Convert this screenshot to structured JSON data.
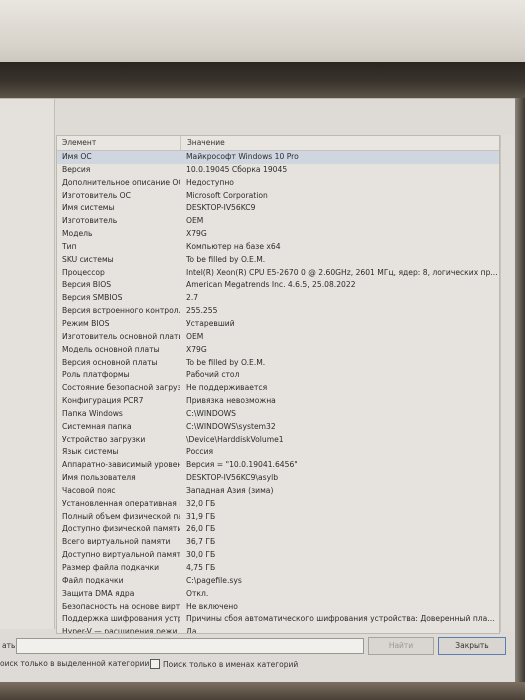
{
  "table": {
    "headers": {
      "element": "Элемент",
      "value": "Значение"
    },
    "rows": [
      {
        "k": "Имя ОС",
        "v": "Майкрософт Windows 10 Pro"
      },
      {
        "k": "Версия",
        "v": "10.0.19045 Сборка 19045"
      },
      {
        "k": "Дополнительное описание ОС",
        "v": "Недоступно"
      },
      {
        "k": "Изготовитель ОС",
        "v": "Microsoft Corporation"
      },
      {
        "k": "Имя системы",
        "v": "DESKTOP-IV56KC9"
      },
      {
        "k": "Изготовитель",
        "v": "OEM"
      },
      {
        "k": "Модель",
        "v": "X79G"
      },
      {
        "k": "Тип",
        "v": "Компьютер на базе x64"
      },
      {
        "k": "SKU системы",
        "v": "To be filled by O.E.M."
      },
      {
        "k": "Процессор",
        "v": "Intel(R) Xeon(R) CPU E5-2670 0 @ 2.60GHz, 2601 МГц, ядер: 8, логических пр..."
      },
      {
        "k": "Версия BIOS",
        "v": "American Megatrends Inc. 4.6.5, 25.08.2022"
      },
      {
        "k": "Версия SMBIOS",
        "v": "2.7"
      },
      {
        "k": "Версия встроенного контролл...",
        "v": "255.255"
      },
      {
        "k": "Режим BIOS",
        "v": "Устаревший"
      },
      {
        "k": "Изготовитель основной платы",
        "v": "OEM"
      },
      {
        "k": "Модель основной платы",
        "v": "X79G"
      },
      {
        "k": "Версия основной платы",
        "v": "To be filled by O.E.M."
      },
      {
        "k": "Роль платформы",
        "v": "Рабочий стол"
      },
      {
        "k": "Состояние безопасной загруз...",
        "v": "Не поддерживается"
      },
      {
        "k": "Конфигурация PCR7",
        "v": "Привязка невозможна"
      },
      {
        "k": "Папка Windows",
        "v": "C:\\WINDOWS"
      },
      {
        "k": "Системная папка",
        "v": "C:\\WINDOWS\\system32"
      },
      {
        "k": "Устройство загрузки",
        "v": "\\Device\\HarddiskVolume1"
      },
      {
        "k": "Язык системы",
        "v": "Россия"
      },
      {
        "k": "Аппаратно-зависимый уровен...",
        "v": "Версия = \"10.0.19041.6456\""
      },
      {
        "k": "Имя пользователя",
        "v": "DESKTOP-IV56KC9\\asylb"
      },
      {
        "k": "Часовой пояс",
        "v": "Западная Азия (зима)"
      },
      {
        "k": "Установленная оперативная п...",
        "v": "32,0 ГБ"
      },
      {
        "k": "Полный объем физической па...",
        "v": "31,9 ГБ"
      },
      {
        "k": "Доступно физической памяти",
        "v": "26,0 ГБ"
      },
      {
        "k": "Всего виртуальной памяти",
        "v": "36,7 ГБ"
      },
      {
        "k": "Доступно виртуальной памяти",
        "v": "30,0 ГБ"
      },
      {
        "k": "Размер файла подкачки",
        "v": "4,75 ГБ"
      },
      {
        "k": "Файл подкачки",
        "v": "C:\\pagefile.sys"
      },
      {
        "k": "Защита DMA ядра",
        "v": "Откл."
      },
      {
        "k": "Безопасность на основе вирту...",
        "v": "Не включено"
      },
      {
        "k": "Поддержка шифрования устр...",
        "v": "Причины сбоя автоматического шифрования устройства: Доверенный пла..."
      },
      {
        "k": "Hyper-V — расширения режи...",
        "v": "Да"
      }
    ]
  },
  "search": {
    "label": "ать:",
    "find_label": "Найти",
    "close_label": "Закрыть",
    "check_category": "оиск только в выделенной категории",
    "check_names": "Поиск только в именах категорий"
  }
}
